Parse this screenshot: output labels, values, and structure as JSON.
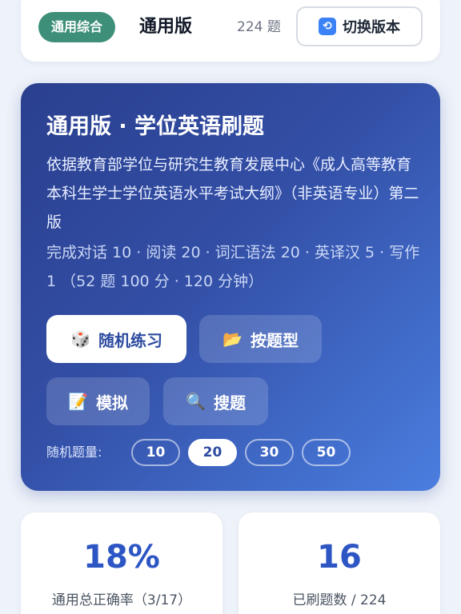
{
  "header": {
    "badge": "通用综合",
    "version_name": "通用版",
    "question_count": "224 题",
    "switch_icon": "arrows-cycle-icon",
    "switch_label": "切换版本"
  },
  "hero": {
    "title": "通用版 · 学位英语刷题",
    "description": "依据教育部学位与研究生教育发展中心《成人高等教育本科生学士学位英语水平考试大纲》（非英语专业）第二版",
    "meta": "完成对话 10 · 阅读 20 · 词汇语法 20 · 英译汉 5 · 写作 1 （52 题 100 分 · 120 分钟）",
    "buttons": [
      {
        "icon": "dice-icon",
        "glyph": "🎲",
        "label": "随机练习"
      },
      {
        "icon": "folder-icon",
        "glyph": "📂",
        "label": "按题型"
      },
      {
        "icon": "memo-icon",
        "glyph": "📝",
        "label": "模拟"
      },
      {
        "icon": "magnifier-icon",
        "glyph": "🔍",
        "label": "搜题"
      }
    ],
    "quantity_label": "随机题量:",
    "quantity_options": [
      "10",
      "20",
      "30",
      "50"
    ],
    "quantity_selected": "20"
  },
  "stats": [
    {
      "value": "18%",
      "label": "通用总正确率（3/17）"
    },
    {
      "value": "16",
      "label": "已刷题数 / 224"
    }
  ],
  "colors": {
    "accent": "#2d56c4",
    "badge": "#3d8f7a",
    "hero_start": "#2a3f8e",
    "hero_end": "#4a7ee0"
  }
}
